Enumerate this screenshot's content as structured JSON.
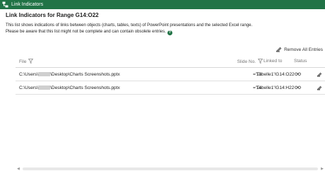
{
  "window": {
    "title": "Link Indicators"
  },
  "heading": "Link Indicators for Range G14:O22",
  "description": {
    "line1": "This list shows indications of links between objects (charts, tables, texts) of PowerPoint presentations and the selected Excel range.",
    "line2": "Please be aware that this list might not be complete and can contain obsolete entries."
  },
  "toolbar": {
    "remove_all_label": "Remove All Entries"
  },
  "table": {
    "columns": {
      "file": "File",
      "slide": "Slide No.",
      "linked": "Linked to",
      "status": "Status"
    },
    "rows": [
      {
        "file_prefix": "C:\\Users\\",
        "file_suffix": "\\Desktop\\Charts Screenshots.pptx",
        "slide": "13",
        "linked": "='Tabelle1'!G14:O22"
      },
      {
        "file_prefix": "C:\\Users\\",
        "file_suffix": "\\Desktop\\Charts Screenshots.pptx",
        "slide": "14",
        "linked": "='Tabelle1'!G14:H22"
      }
    ]
  },
  "colors": {
    "titlebar": "#217346",
    "help": "#217346"
  },
  "icons": {
    "app": "link-indicator-icon",
    "help": "help-icon",
    "remove": "eraser-icon",
    "filter": "filter-icon",
    "status": "link-chain-icon"
  }
}
